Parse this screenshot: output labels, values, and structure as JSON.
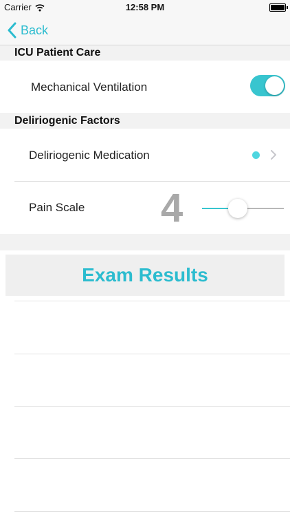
{
  "status_bar": {
    "carrier": "Carrier",
    "time": "12:58 PM"
  },
  "nav": {
    "back_label": "Back"
  },
  "sections": [
    {
      "header": "ICU Patient Care",
      "rows": [
        {
          "label": "Mechanical Ventilation",
          "toggle_on": true
        }
      ]
    },
    {
      "header": "Deliriogenic Factors",
      "rows": [
        {
          "label": "Deliriogenic Medication"
        },
        {
          "label": "Pain Scale",
          "value": "4",
          "slider_fraction": 0.44
        }
      ]
    }
  ],
  "exam_button": {
    "label": "Exam Results"
  },
  "colors": {
    "accent": "#2cbccf",
    "toggle_on": "#38c5cf",
    "dot": "#4fd6e0",
    "value_gray": "#a9a9a9"
  },
  "icons": {
    "wifi": "wifi-icon",
    "battery": "battery-icon",
    "back": "chevron-left-icon",
    "disclosure": "chevron-right-icon"
  }
}
